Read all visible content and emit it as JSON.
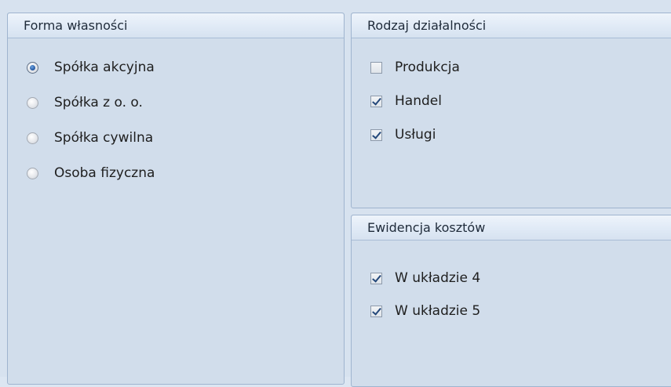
{
  "forma": {
    "title": "Forma własności",
    "options": [
      {
        "label": "Spółka akcyjna",
        "selected": true
      },
      {
        "label": "Spółka z o. o.",
        "selected": false
      },
      {
        "label": "Spółka cywilna",
        "selected": false
      },
      {
        "label": "Osoba fizyczna",
        "selected": false
      }
    ]
  },
  "rodzaj": {
    "title": "Rodzaj działalności",
    "options": [
      {
        "label": "Produkcja",
        "checked": false
      },
      {
        "label": "Handel",
        "checked": true
      },
      {
        "label": "Usługi",
        "checked": true
      }
    ]
  },
  "ewidencja": {
    "title": "Ewidencja kosztów",
    "options": [
      {
        "label": "W układzie 4",
        "checked": true
      },
      {
        "label": "W układzie 5",
        "checked": true
      }
    ]
  }
}
